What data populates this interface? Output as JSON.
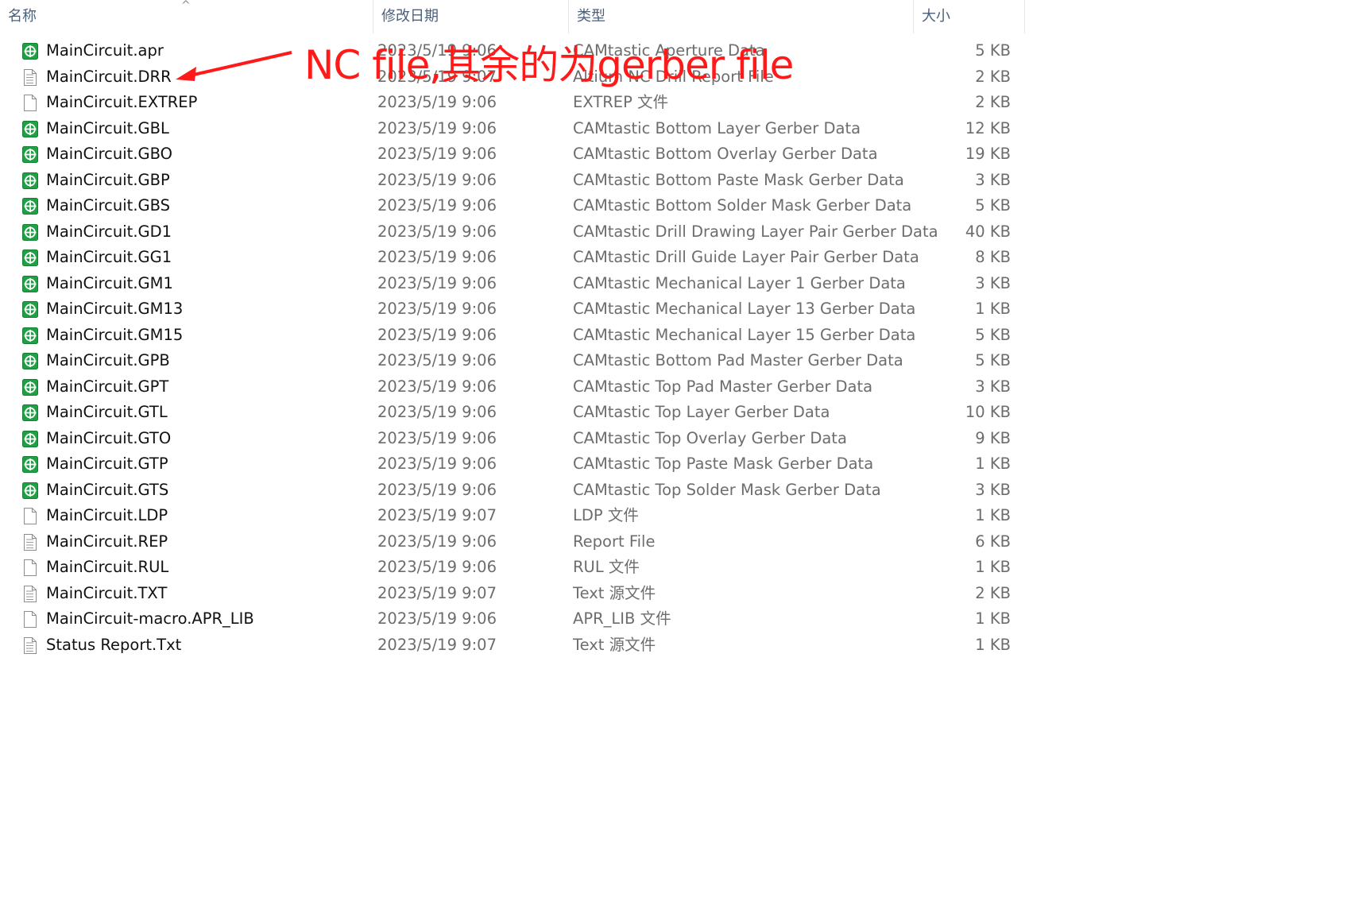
{
  "columns": {
    "name": "名称",
    "modified": "修改日期",
    "type": "类型",
    "size": "大小",
    "sort_indicator": "^"
  },
  "annotation": "NC file,其余的为gerber file",
  "colors": {
    "annotation": "#ff1a1a",
    "gerber_icon": "#20a045",
    "header_text": "#4c607a"
  },
  "files": [
    {
      "name": "MainCircuit.apr",
      "date": "2023/5/19 9:06",
      "type": "CAMtastic Aperture Data",
      "size": "5 KB",
      "icon": "gerber-icon"
    },
    {
      "name": "MainCircuit.DRR",
      "date": "2023/5/19 9:07",
      "type": "Altium NC Drill Report File",
      "size": "2 KB",
      "icon": "report-icon"
    },
    {
      "name": "MainCircuit.EXTREP",
      "date": "2023/5/19 9:06",
      "type": "EXTREP 文件",
      "size": "2 KB",
      "icon": "blank-file-icon"
    },
    {
      "name": "MainCircuit.GBL",
      "date": "2023/5/19 9:06",
      "type": "CAMtastic Bottom Layer Gerber Data",
      "size": "12 KB",
      "icon": "gerber-icon"
    },
    {
      "name": "MainCircuit.GBO",
      "date": "2023/5/19 9:06",
      "type": "CAMtastic Bottom Overlay Gerber Data",
      "size": "19 KB",
      "icon": "gerber-icon"
    },
    {
      "name": "MainCircuit.GBP",
      "date": "2023/5/19 9:06",
      "type": "CAMtastic Bottom Paste Mask Gerber Data",
      "size": "3 KB",
      "icon": "gerber-icon"
    },
    {
      "name": "MainCircuit.GBS",
      "date": "2023/5/19 9:06",
      "type": "CAMtastic Bottom Solder Mask Gerber Data",
      "size": "5 KB",
      "icon": "gerber-icon"
    },
    {
      "name": "MainCircuit.GD1",
      "date": "2023/5/19 9:06",
      "type": "CAMtastic Drill Drawing Layer Pair Gerber Data",
      "size": "40 KB",
      "icon": "gerber-icon"
    },
    {
      "name": "MainCircuit.GG1",
      "date": "2023/5/19 9:06",
      "type": "CAMtastic Drill Guide Layer Pair Gerber Data",
      "size": "8 KB",
      "icon": "gerber-icon"
    },
    {
      "name": "MainCircuit.GM1",
      "date": "2023/5/19 9:06",
      "type": "CAMtastic Mechanical Layer 1 Gerber Data",
      "size": "3 KB",
      "icon": "gerber-icon"
    },
    {
      "name": "MainCircuit.GM13",
      "date": "2023/5/19 9:06",
      "type": "CAMtastic Mechanical Layer 13 Gerber Data",
      "size": "1 KB",
      "icon": "gerber-icon"
    },
    {
      "name": "MainCircuit.GM15",
      "date": "2023/5/19 9:06",
      "type": "CAMtastic Mechanical Layer 15 Gerber Data",
      "size": "5 KB",
      "icon": "gerber-icon"
    },
    {
      "name": "MainCircuit.GPB",
      "date": "2023/5/19 9:06",
      "type": "CAMtastic Bottom Pad Master Gerber Data",
      "size": "5 KB",
      "icon": "gerber-icon"
    },
    {
      "name": "MainCircuit.GPT",
      "date": "2023/5/19 9:06",
      "type": "CAMtastic Top Pad Master Gerber Data",
      "size": "3 KB",
      "icon": "gerber-icon"
    },
    {
      "name": "MainCircuit.GTL",
      "date": "2023/5/19 9:06",
      "type": "CAMtastic Top Layer Gerber Data",
      "size": "10 KB",
      "icon": "gerber-icon"
    },
    {
      "name": "MainCircuit.GTO",
      "date": "2023/5/19 9:06",
      "type": "CAMtastic Top Overlay Gerber Data",
      "size": "9 KB",
      "icon": "gerber-icon"
    },
    {
      "name": "MainCircuit.GTP",
      "date": "2023/5/19 9:06",
      "type": "CAMtastic Top Paste Mask Gerber Data",
      "size": "1 KB",
      "icon": "gerber-icon"
    },
    {
      "name": "MainCircuit.GTS",
      "date": "2023/5/19 9:06",
      "type": "CAMtastic Top Solder Mask Gerber Data",
      "size": "3 KB",
      "icon": "gerber-icon"
    },
    {
      "name": "MainCircuit.LDP",
      "date": "2023/5/19 9:07",
      "type": "LDP 文件",
      "size": "1 KB",
      "icon": "blank-file-icon"
    },
    {
      "name": "MainCircuit.REP",
      "date": "2023/5/19 9:06",
      "type": "Report File",
      "size": "6 KB",
      "icon": "report-icon"
    },
    {
      "name": "MainCircuit.RUL",
      "date": "2023/5/19 9:06",
      "type": "RUL 文件",
      "size": "1 KB",
      "icon": "blank-file-icon"
    },
    {
      "name": "MainCircuit.TXT",
      "date": "2023/5/19 9:07",
      "type": "Text 源文件",
      "size": "2 KB",
      "icon": "text-file-icon"
    },
    {
      "name": "MainCircuit-macro.APR_LIB",
      "date": "2023/5/19 9:06",
      "type": "APR_LIB 文件",
      "size": "1 KB",
      "icon": "blank-file-icon"
    },
    {
      "name": "Status Report.Txt",
      "date": "2023/5/19 9:07",
      "type": "Text 源文件",
      "size": "1 KB",
      "icon": "text-file-icon"
    }
  ]
}
